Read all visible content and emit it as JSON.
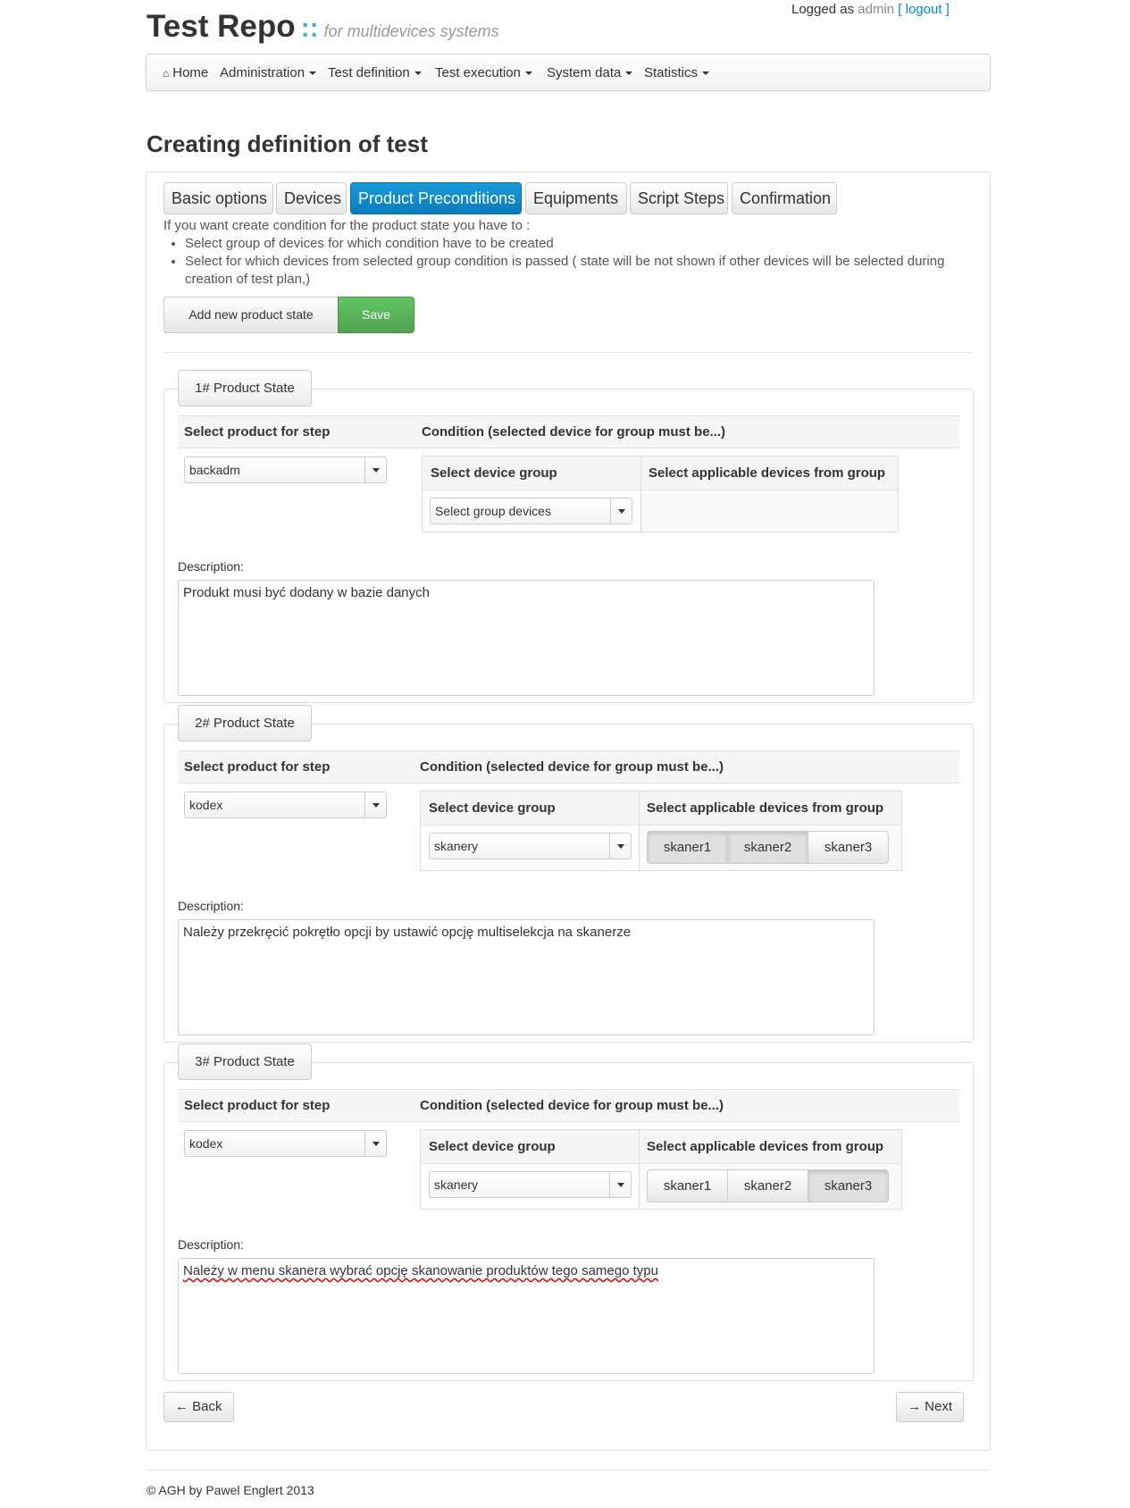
{
  "header": {
    "app_name": "Test Repo",
    "separator": "::",
    "tagline": "for multidevices systems",
    "logged_as": "Logged as",
    "user": "admin",
    "logout": "[ logout ]"
  },
  "nav": {
    "home": "Home",
    "items": [
      "Administration",
      "Test definition",
      "Test execution",
      "System data",
      "Statistics"
    ]
  },
  "page_title": "Creating definition of test",
  "tabs": [
    "Basic options",
    "Devices",
    "Product Preconditions",
    "Equipments",
    "Script Steps",
    "Confirmation"
  ],
  "intro": {
    "text": "If you want create condition for the product state you have to :",
    "bullets": [
      "Select group of devices for which condition have to be created",
      "Select for which devices from selected group condition is passed ( state will be not shown if other devices will be selected during creation of test plan,)"
    ]
  },
  "actions": {
    "add": "Add new product state",
    "save": "Save"
  },
  "labels": {
    "product_col": "Select product for step",
    "condition_col": "Condition (selected device for group must be...)",
    "device_group_col": "Select device group",
    "applicable_col": "Select applicable devices from group",
    "description": "Description:"
  },
  "states": [
    {
      "legend": "1# Product State",
      "product": "backadm",
      "device_group": "Select group devices",
      "devices": [],
      "description": "Produkt musi być dodany w bazie danych"
    },
    {
      "legend": "2# Product State",
      "product": "kodex",
      "device_group": "skanery",
      "devices": [
        "skaner1",
        "skaner2",
        "skaner3"
      ],
      "selected_devices": [
        "skaner1",
        "skaner2"
      ],
      "description": "Należy przekręcić pokrętło opcji by ustawić opcję multiselekcja na skanerze"
    },
    {
      "legend": "3# Product State",
      "product": "kodex",
      "device_group": "skanery",
      "devices": [
        "skaner1",
        "skaner2",
        "skaner3"
      ],
      "selected_devices": [
        "skaner3"
      ],
      "description": "Należy w menu skanera wybrać opcję skanowanie produktów tego samego typu"
    }
  ],
  "pager": {
    "back": "Back",
    "next": "Next"
  },
  "footer": "© AGH by Pawel Englert 2013",
  "colors": {
    "active_tab": "#0e90d2",
    "save": "#5bb75b",
    "link": "#0088cc"
  }
}
